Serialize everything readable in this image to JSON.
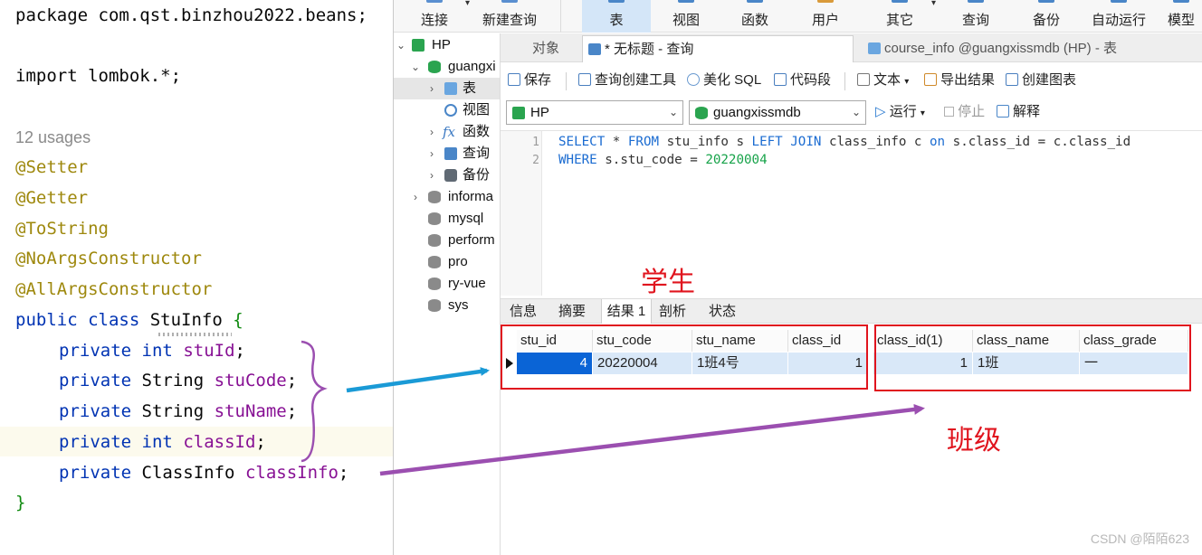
{
  "editor": {
    "lines": [
      "package com.qst.binzhou2022.beans;",
      "import lombok.*;"
    ],
    "usages_hint": "12 usages",
    "annotations": [
      "@Setter",
      "@Getter",
      "@ToString",
      "@NoArgsConstructor",
      "@AllArgsConstructor"
    ],
    "class_decl": {
      "kw": "public class",
      "name": "StuInfo",
      "brace": "{"
    },
    "fields": [
      {
        "mod": "private",
        "type": "int",
        "name": "stuId"
      },
      {
        "mod": "private",
        "type": "String",
        "name": "stuCode"
      },
      {
        "mod": "private",
        "type": "String",
        "name": "stuName"
      },
      {
        "mod": "private",
        "type": "int",
        "name": "classId"
      },
      {
        "mod": "private",
        "type": "ClassInfo",
        "name": "classInfo"
      }
    ],
    "close_brace": "}"
  },
  "main_toolbar": {
    "items": [
      {
        "label": "连接"
      },
      {
        "label": "新建查询"
      },
      {
        "label": "表"
      },
      {
        "label": "视图"
      },
      {
        "label": "函数"
      },
      {
        "label": "用户"
      },
      {
        "label": "其它"
      },
      {
        "label": "查询"
      },
      {
        "label": "备份"
      },
      {
        "label": "自动运行"
      },
      {
        "label": "模型"
      }
    ]
  },
  "sidebar": {
    "items": [
      {
        "label": "HP"
      },
      {
        "label": "guangxi"
      },
      {
        "label": "表"
      },
      {
        "label": "视图"
      },
      {
        "label": "函数"
      },
      {
        "label": "查询"
      },
      {
        "label": "备份"
      },
      {
        "label": "informa"
      },
      {
        "label": "mysql"
      },
      {
        "label": "perform"
      },
      {
        "label": "pro"
      },
      {
        "label": "ry-vue"
      },
      {
        "label": "sys"
      }
    ]
  },
  "tabs": [
    {
      "label": "对象"
    },
    {
      "label": "* 无标题 - 查询"
    },
    {
      "label": "course_info @guangxissmdb (HP) - 表"
    }
  ],
  "query_toolbar": {
    "save": "保存",
    "builder": "查询创建工具",
    "beautify": "美化 SQL",
    "snippet": "代码段",
    "text": "文本",
    "export": "导出结果",
    "chart": "创建图表"
  },
  "connection": {
    "server": "HP",
    "database": "guangxissmdb",
    "run": "运行",
    "stop": "停止",
    "explain": "解释"
  },
  "sql": {
    "line_numbers": [
      "1",
      "2"
    ],
    "line1": {
      "kw1": "SELECT",
      "t1": " * ",
      "kw2": "FROM",
      "t2": " stu_info s ",
      "kw3": "LEFT JOIN",
      "t3": " class_info c ",
      "kw4": "on",
      "t4": " s.class_id = c.class_id"
    },
    "line2": {
      "kw1": "WHERE",
      "t1": " s.stu_code = ",
      "num": "20220004"
    }
  },
  "result_tabs": [
    {
      "label": "信息"
    },
    {
      "label": "摘要"
    },
    {
      "label": "结果 1"
    },
    {
      "label": "剖析"
    },
    {
      "label": "状态"
    }
  ],
  "grid": {
    "columns": [
      "stu_id",
      "stu_code",
      "stu_name",
      "class_id",
      "class_id(1)",
      "class_name",
      "class_grade"
    ],
    "rows": [
      [
        "4",
        "20220004",
        "1班4号",
        "1",
        "1",
        "1班",
        "一"
      ]
    ]
  },
  "annotations": {
    "student_label": "学生",
    "class_label": "班级",
    "red": "#e0141e",
    "blue_arrow": "#1a9ad6",
    "purple_arrow": "#9b4fb0"
  },
  "watermark": "CSDN @陌陌623"
}
